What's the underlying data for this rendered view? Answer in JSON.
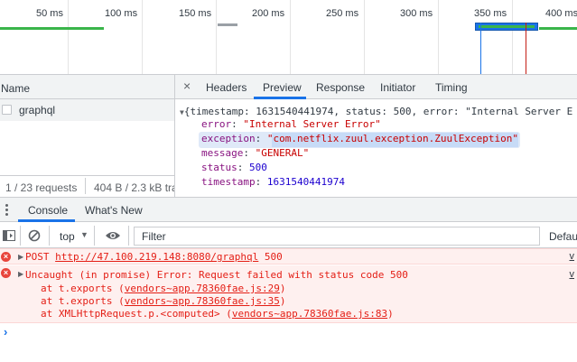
{
  "timeline": {
    "ticks": [
      "50 ms",
      "100 ms",
      "150 ms",
      "200 ms",
      "250 ms",
      "300 ms",
      "350 ms",
      "400 ms"
    ]
  },
  "network": {
    "name_header": "Name",
    "request_name": "graphql",
    "footer_requests": "1 / 23 requests",
    "footer_transfer": "404 B / 2.3 kB tra"
  },
  "detail_tabs": {
    "close_label": "×",
    "headers": "Headers",
    "preview": "Preview",
    "response": "Response",
    "initiator": "Initiator",
    "timing": "Timing",
    "active": "Preview"
  },
  "preview": {
    "summary": "{timestamp: 1631540441974, status: 500, error: \"Internal Server E",
    "error_key": "error",
    "error_val": "\"Internal Server Error\"",
    "exception_key": "exception",
    "exception_val": "\"com.netflix.zuul.exception.ZuulException\"",
    "message_key": "message",
    "message_val": "\"GENERAL\"",
    "status_key": "status",
    "status_val": "500",
    "timestamp_key": "timestamp",
    "timestamp_val": "1631540441974"
  },
  "drawer": {
    "tab_console": "Console",
    "tab_whats_new": "What's New",
    "context": "top",
    "filter_placeholder": "Filter",
    "levels": "Defau"
  },
  "console": {
    "msg1_method": "POST",
    "msg1_url": "http://47.100.219.148:8080/graphql",
    "msg1_status": "500",
    "msg1_src": "v",
    "msg2_text": "Uncaught (in promise) Error: Request failed with status code 500",
    "msg2_src": "v",
    "stack": [
      {
        "prefix": "at t.exports (",
        "link": "vendors~app.78360fae.js:29",
        "suffix": ")"
      },
      {
        "prefix": "at t.exports (",
        "link": "vendors~app.78360fae.js:35",
        "suffix": ")"
      },
      {
        "prefix": "at XMLHttpRequest.p.<computed> (",
        "link": "vendors~app.78360fae.js:83",
        "suffix": ")"
      }
    ],
    "prompt": "›"
  },
  "colors": {
    "accent": "#1a73e8",
    "error": "#e41e15",
    "error_bg": "#fef0ef",
    "key": "#881280",
    "string": "#c80000",
    "number": "#1c00cf"
  }
}
